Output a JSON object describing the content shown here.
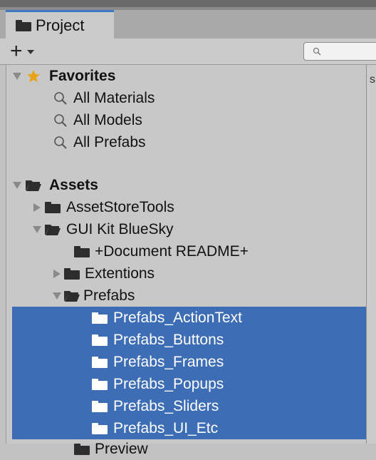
{
  "colors": {
    "selection": "#3d6db5",
    "tab_accent": "#3f78c0",
    "panel_bg": "#c8c8c8",
    "star": "#e8a317"
  },
  "tab": {
    "label": "Project",
    "icon": "folder-icon"
  },
  "toolbar": {
    "create_label": "+",
    "search_placeholder": ""
  },
  "right_panel": {
    "edge_char": "s"
  },
  "tree": {
    "favorites": {
      "label": "Favorites",
      "items": [
        "All Materials",
        "All Models",
        "All Prefabs"
      ]
    },
    "assets": {
      "label": "Assets",
      "asset_store_tools": "AssetStoreTools",
      "gui_kit": "GUI Kit BlueSky",
      "document_readme": "+Document README+",
      "extentions": "Extentions",
      "prefabs": "Prefabs",
      "prefab_folders": [
        "Prefabs_ActionText",
        "Prefabs_Buttons",
        "Prefabs_Frames",
        "Prefabs_Popups",
        "Prefabs_Sliders",
        "Prefabs_UI_Etc"
      ],
      "preview": "Preview"
    }
  }
}
